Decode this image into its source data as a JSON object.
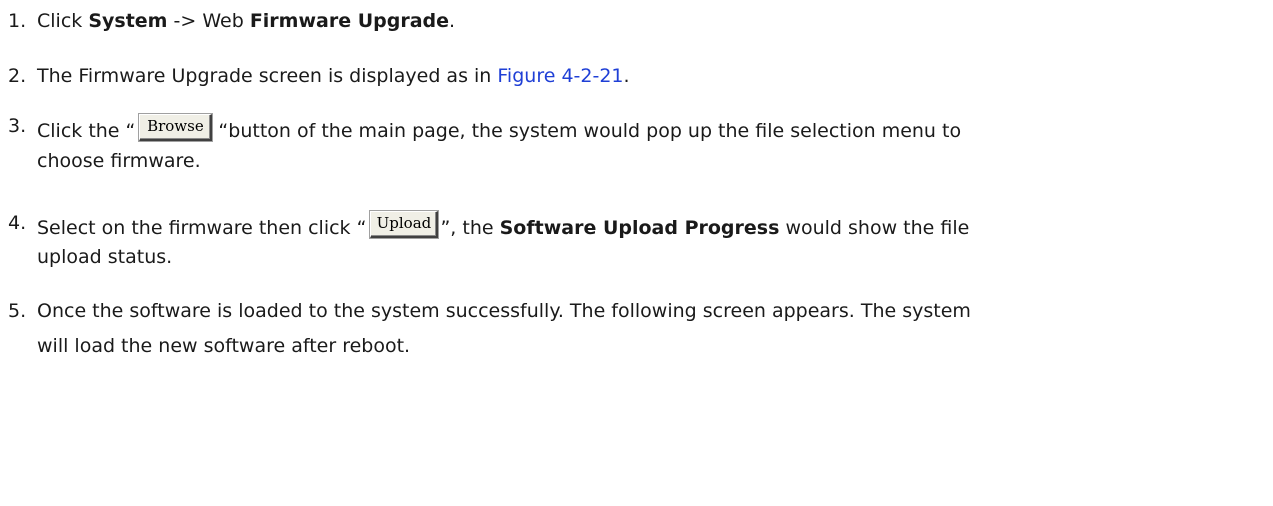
{
  "steps": [
    {
      "num": "1.",
      "before": "Click ",
      "bold1": "System",
      "middle": " -> Web ",
      "bold2": "Firmware Upgrade",
      "after": "."
    },
    {
      "num": "2.",
      "before": "The Firmware Upgrade screen is displayed as in ",
      "link": "Figure 4-2-21",
      "after": "."
    },
    {
      "num": "3.",
      "before": "Click the “",
      "button": "Browse",
      "after": " “button of the main page, the system would pop up the file selection menu to",
      "cont": "choose firmware."
    },
    {
      "num": "4.",
      "before": "Select on the firmware then click “",
      "button": "Upload",
      "middle": "”, the ",
      "bold": "Software Upload Progress",
      "after": " would show the file",
      "cont": "upload status."
    },
    {
      "num": "5.",
      "text": "Once the software is loaded to the system successfully. The following screen appears. The system",
      "cont": "will load the new software after reboot."
    }
  ],
  "colors": {
    "text": "#1a1a1a",
    "link": "#1f3fd6"
  }
}
